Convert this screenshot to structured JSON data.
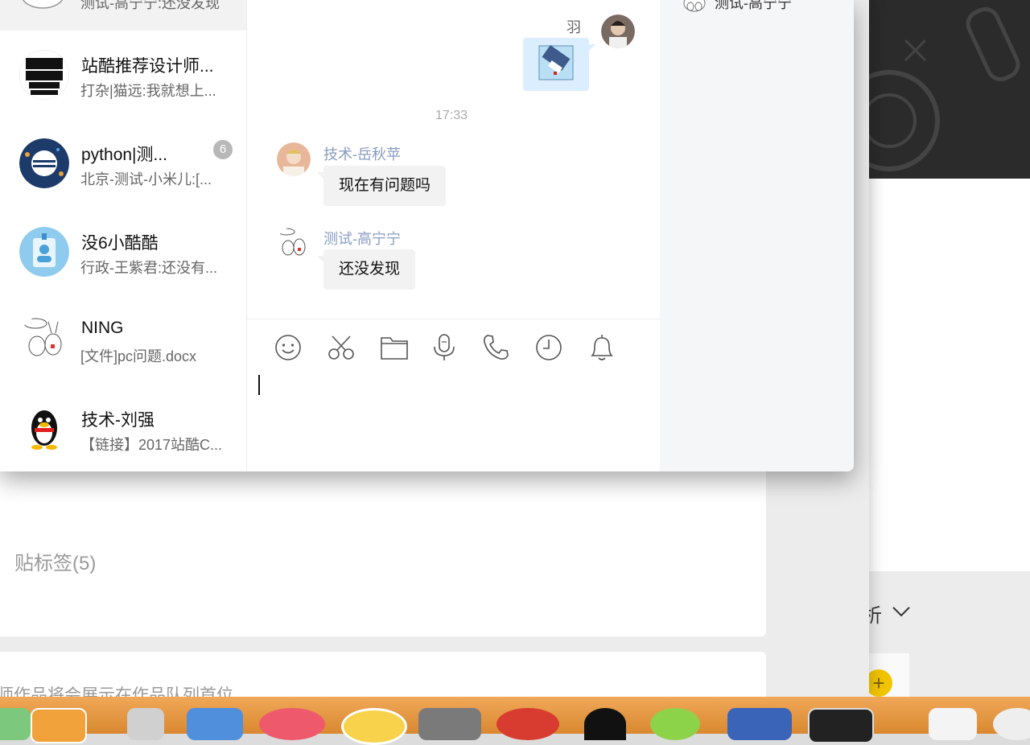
{
  "top_partial": {
    "preview": "测试-高宁宁:还没发现"
  },
  "conversations": [
    {
      "title": "站酷推荐设计师...",
      "preview": "打杂|猫远:我就想上..."
    },
    {
      "title": "python|测...",
      "preview": "北京-测试-小米儿:[...",
      "badge": "6"
    },
    {
      "title": "没6小酷酷",
      "preview": "行政-王紫君:还没有..."
    },
    {
      "title": "NING",
      "preview": "[文件]pc问题.docx"
    },
    {
      "title": "技术-刘强",
      "preview": "【链接】2017站酷C..."
    }
  ],
  "chat": {
    "my_name": "羽",
    "timestamp": "17:33",
    "messages": [
      {
        "sender": "技术-岳秋苹",
        "text": "现在有问题吗"
      },
      {
        "sender": "测试-高宁宁",
        "text": "还没发现"
      }
    ]
  },
  "member_panel": {
    "name": "测试-高宁宁"
  },
  "toolbar": [
    "smile-icon",
    "scissors-icon",
    "folder-icon",
    "microphone-icon",
    "phone-icon",
    "clock-icon",
    "bell-icon"
  ],
  "background": {
    "tag_label": "贴标签(5)",
    "notice": "师作品将会展示在作品队列首位",
    "right_text": "析"
  },
  "colors": {
    "sender": "#8a9cc0",
    "my_bubble": "#dbeeff",
    "bubble": "#f2f2f2",
    "member_panel": "#f5f6f8",
    "badge": "#b8b8b8"
  }
}
